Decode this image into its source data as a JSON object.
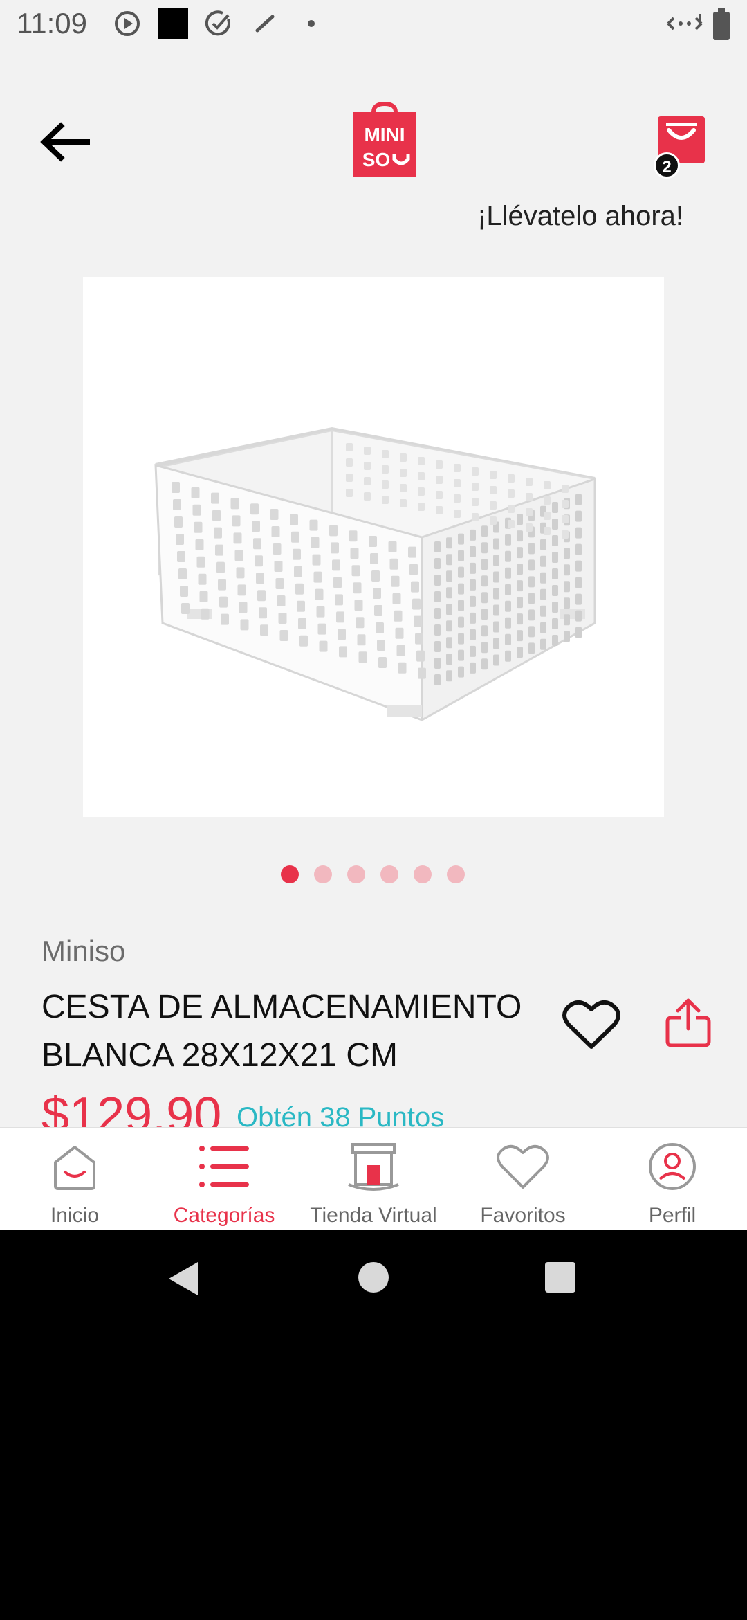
{
  "status_bar": {
    "time": "11:09"
  },
  "header": {
    "logo_text_line1": "MINI",
    "logo_text_line2": "SO",
    "cart_count": "2",
    "promo_text": "¡Llévatelo ahora!"
  },
  "gallery": {
    "image_count": 6,
    "active_index": 0
  },
  "product": {
    "brand": "Miniso",
    "title": "CESTA DE ALMACENAMIENTO BLANCA 28X12X21 CM",
    "price": "$129.90",
    "points": "Obtén 38 Puntos"
  },
  "bottom_nav": {
    "items": [
      {
        "label": "Inicio",
        "icon": "home-icon"
      },
      {
        "label": "Categorías",
        "icon": "categories-icon"
      },
      {
        "label": "Tienda Virtual",
        "icon": "store-icon"
      },
      {
        "label": "Favoritos",
        "icon": "heart-icon"
      },
      {
        "label": "Perfil",
        "icon": "profile-icon"
      }
    ],
    "active": "Categorías"
  },
  "colors": {
    "brand_red": "#e8324a",
    "points_teal": "#2ab8c4",
    "background": "#f2f2f2"
  }
}
